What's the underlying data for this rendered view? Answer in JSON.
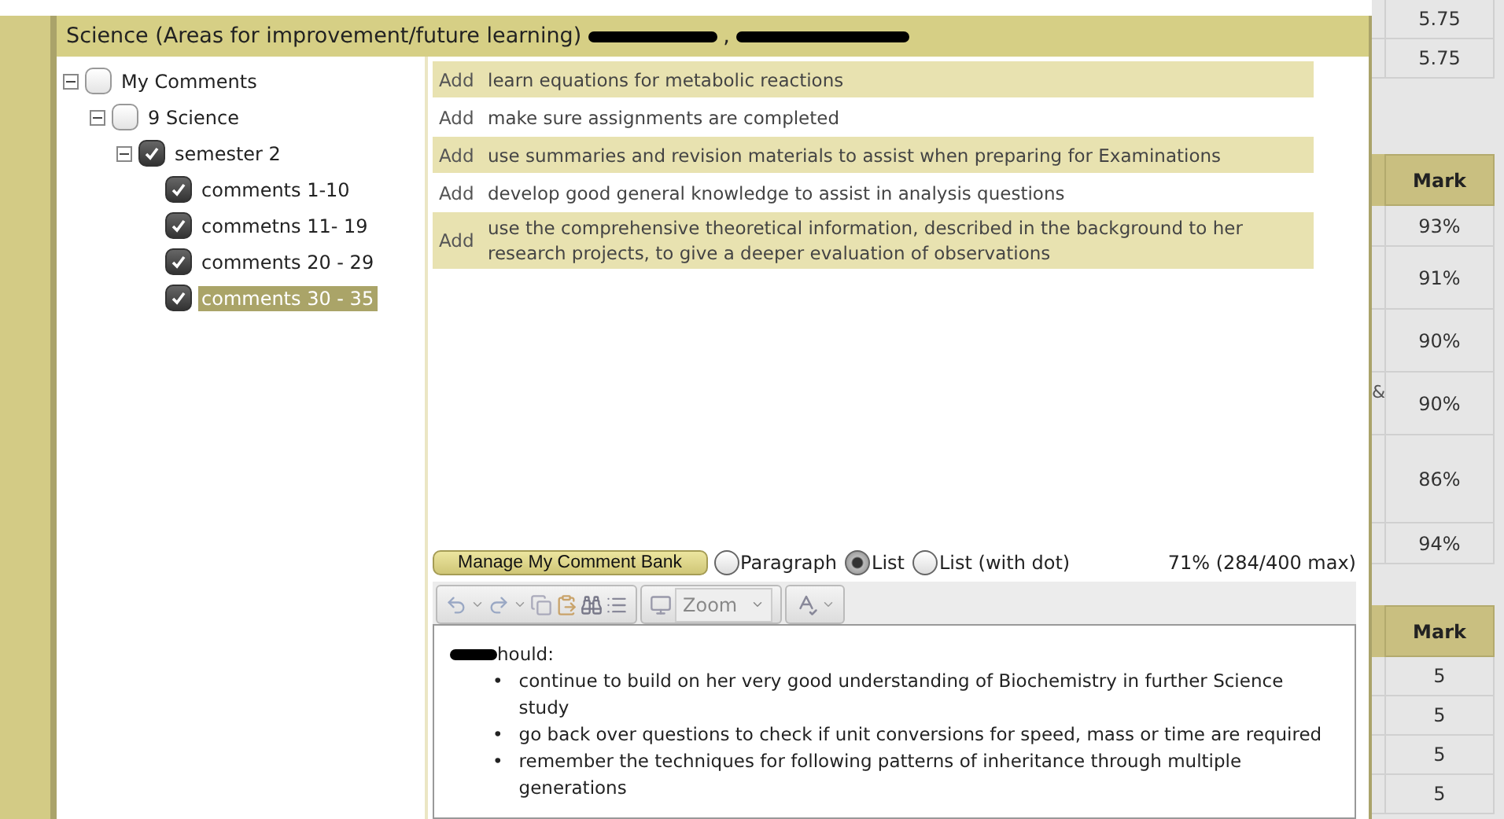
{
  "panel": {
    "title": "Science (Areas for improvement/future learning)",
    "title_separator": ","
  },
  "tree": [
    {
      "label": "My Comments",
      "checked": false,
      "expanded": true,
      "selected": false,
      "children": [
        {
          "label": "9 Science",
          "checked": false,
          "expanded": true,
          "selected": false,
          "children": [
            {
              "label": "semester 2",
              "checked": true,
              "expanded": true,
              "selected": false,
              "children": [
                {
                  "label": "comments 1-10",
                  "checked": true,
                  "selected": false
                },
                {
                  "label": "commetns 11- 19",
                  "checked": true,
                  "selected": false
                },
                {
                  "label": "comments 20 - 29",
                  "checked": true,
                  "selected": false
                },
                {
                  "label": "comments 30 - 35",
                  "checked": true,
                  "selected": true
                }
              ]
            }
          ]
        }
      ]
    }
  ],
  "comments": [
    {
      "action": "Add",
      "text": "learn equations for metabolic reactions"
    },
    {
      "action": "Add",
      "text": "make sure assignments are completed"
    },
    {
      "action": "Add",
      "text": "use summaries and revision materials to assist when preparing for Examinations"
    },
    {
      "action": "Add",
      "text": "develop good general knowledge to assist in analysis questions"
    },
    {
      "action": "Add",
      "text": "use the comprehensive theoretical information, described in the background to her research projects, to give a deeper evaluation of observations"
    }
  ],
  "manage_button": "Manage My Comment Bank",
  "format_options": [
    {
      "label": "Paragraph",
      "selected": false
    },
    {
      "label": "List",
      "selected": true
    },
    {
      "label": "List (with dot)",
      "selected": false
    }
  ],
  "char_count": "71% (284/400 max)",
  "toolbar": {
    "zoom": "Zoom"
  },
  "editor": {
    "intro": "hould:",
    "bullet_marker": "•",
    "bullets": [
      "continue to build on her very good understanding of Biochemistry in further Science study",
      "go back over questions to check if unit conversions for speed, mass or time are required",
      "remember the techniques for following patterns of inheritance through multiple generations"
    ]
  },
  "side_tables": [
    {
      "rows": [
        {
          "mark": "5.75"
        },
        {
          "mark": "5.75"
        }
      ]
    },
    {
      "header": "Mark",
      "rows": [
        {
          "mark": "93%"
        },
        {
          "mark": "91%"
        },
        {
          "mark": "90%"
        },
        {
          "column_1": "&",
          "mark": "90%"
        },
        {
          "mark": "86%"
        },
        {
          "mark": "94%"
        }
      ]
    },
    {
      "header": "Mark",
      "rows": [
        {
          "mark": "5"
        },
        {
          "mark": "5"
        },
        {
          "mark": "5"
        },
        {
          "mark": "5"
        }
      ]
    }
  ]
}
